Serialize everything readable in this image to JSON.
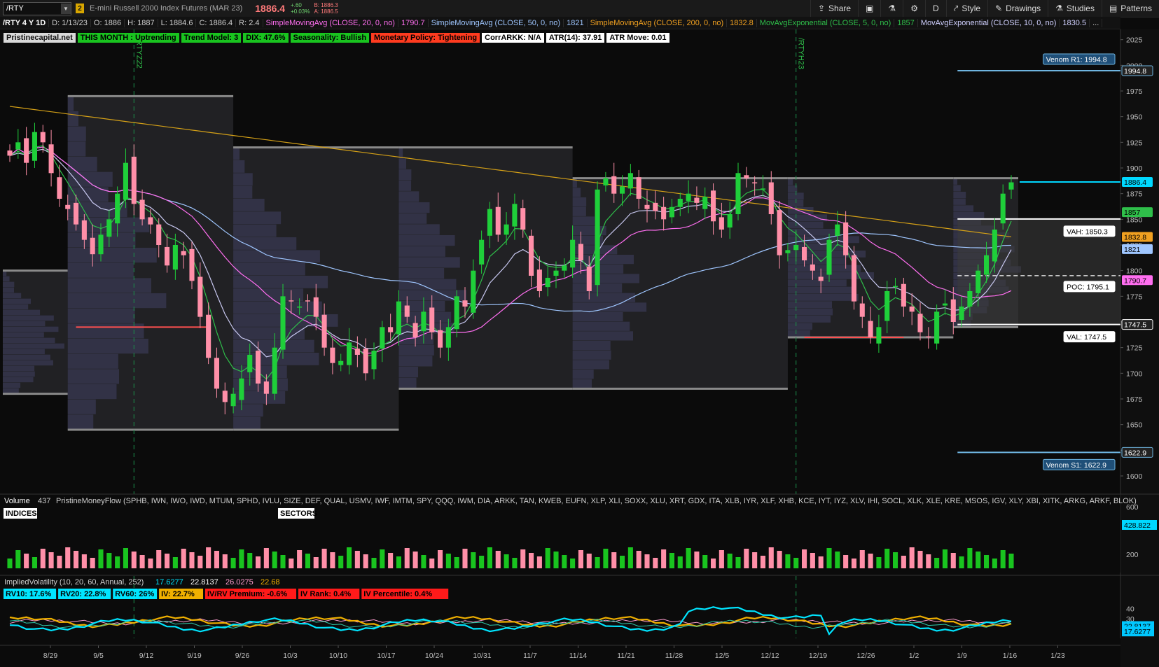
{
  "toolbar": {
    "symbol": "/RTY",
    "link_number": "2",
    "description": "E-mini Russell 2000 Index Futures (MAR 23)",
    "last": "1886.4",
    "change": "+.60",
    "change_pct": "+0.03%",
    "bid": "B: 1886.3",
    "ask": "A: 1886.5",
    "buttons": [
      {
        "label": "Share",
        "icon": "share-icon",
        "glyph": "⇪"
      },
      {
        "label": "",
        "icon": "flexible-grid-icon",
        "glyph": "▣"
      },
      {
        "label": "",
        "icon": "flask-icon",
        "glyph": "⚗"
      },
      {
        "label": "",
        "icon": "gear-icon",
        "glyph": "⚙"
      },
      {
        "label": "D",
        "icon": "",
        "glyph": ""
      },
      {
        "label": "Style",
        "icon": "style-icon",
        "glyph": "⤤"
      },
      {
        "label": "Drawings",
        "icon": "drawings-icon",
        "glyph": "✎"
      },
      {
        "label": "Studies",
        "icon": "studies-icon",
        "glyph": "⚗"
      },
      {
        "label": "Patterns",
        "icon": "patterns-icon",
        "glyph": "▤"
      }
    ]
  },
  "study_header": [
    {
      "text": "/RTY 4 Y 1D",
      "color": "#ffffff",
      "bold": true
    },
    {
      "text": "D: 1/13/23",
      "color": "#cfcfcf"
    },
    {
      "text": "O: 1886",
      "color": "#cfcfcf"
    },
    {
      "text": "H: 1887",
      "color": "#cfcfcf"
    },
    {
      "text": "L: 1884.6",
      "color": "#cfcfcf"
    },
    {
      "text": "C: 1886.4",
      "color": "#cfcfcf"
    },
    {
      "text": "R: 2.4",
      "color": "#cfcfcf"
    },
    {
      "text": "SimpleMovingAvg (CLOSE, 20, 0, no)",
      "color": "#ff6ef0"
    },
    {
      "text": "1790.7",
      "color": "#ff6ef0"
    },
    {
      "text": "SimpleMovingAvg (CLOSE, 50, 0, no)",
      "color": "#9fc6ff"
    },
    {
      "text": "1821",
      "color": "#9fc6ff"
    },
    {
      "text": "SimpleMovingAvg (CLOSE, 200, 0, no)",
      "color": "#f0a020"
    },
    {
      "text": "1832.8",
      "color": "#f0a020"
    },
    {
      "text": "MovAvgExponential (CLOSE, 5, 0, no)",
      "color": "#2fbf4a"
    },
    {
      "text": "1857",
      "color": "#2fbf4a"
    },
    {
      "text": "MovAvgExponential (CLOSE, 10, 0, no)",
      "color": "#d0d0ff"
    },
    {
      "text": "1830.5",
      "color": "#d0d0ff"
    },
    {
      "text": "...",
      "color": "#cfcfcf"
    }
  ],
  "pills": [
    {
      "text": "Pristinecapital.net",
      "bg": "#d9d9d9",
      "fg": "#111111"
    },
    {
      "text": "THIS MONTH : Uptrending",
      "bg": "#19c41f",
      "fg": "#000000"
    },
    {
      "text": "Trend Model: 3",
      "bg": "#19c41f",
      "fg": "#000000"
    },
    {
      "text": "DIX: 47.6%",
      "bg": "#19c41f",
      "fg": "#000000"
    },
    {
      "text": "Seasonality: Bullish",
      "bg": "#19c41f",
      "fg": "#000000"
    },
    {
      "text": "Monetary Policy: Tightening",
      "bg": "#ff3b1f",
      "fg": "#000000"
    },
    {
      "text": "CorrARKK: N/A",
      "bg": "#ffffff",
      "fg": "#000000"
    },
    {
      "text": "ATR(14): 37.91",
      "bg": "#ffffff",
      "fg": "#000000"
    },
    {
      "text": "ATR Move: 0.01",
      "bg": "#ffffff",
      "fg": "#000000"
    }
  ],
  "period_markers": [
    "/RTYZ22",
    "/RTYH23"
  ],
  "price_levels": {
    "venom_r1": {
      "label": "Venom R1: 1994.8",
      "value": 1994.8,
      "tag": "1994.8"
    },
    "venom_s1": {
      "label": "Venom S1: 1622.9",
      "value": 1622.9,
      "tag": "1622.9"
    },
    "vah": {
      "label": "VAH: 1850.3",
      "value": 1850.3
    },
    "poc": {
      "label": "POC: 1795.1",
      "value": 1795.1
    },
    "val": {
      "label": "VAL: 1747.5",
      "value": 1747.5,
      "tag": "1747.5"
    }
  },
  "axis_tags": [
    {
      "text": "1886.4",
      "value": 1886.4,
      "bg": "#00d8ff",
      "fg": "#000000"
    },
    {
      "text": "1857",
      "value": 1857,
      "bg": "#2fbf4a",
      "fg": "#000000"
    },
    {
      "text": "1832.8",
      "value": 1832.8,
      "bg": "#f0a020",
      "fg": "#000000"
    },
    {
      "text": "1821",
      "value": 1821,
      "bg": "#9fc6ff",
      "fg": "#000000"
    },
    {
      "text": "1790.7",
      "value": 1790.7,
      "bg": "#ff6ef0",
      "fg": "#000000"
    }
  ],
  "volume_panel": {
    "title": "Volume",
    "value": "437",
    "study": "PristineMoneyFlow (SPHB, IWN, IWO, IWD, MTUM, SPHD, IVLU, SIZE, DEF, QUAL, USMV, IWF, IMTM, SPY, QQQ, IWM, DIA, ARKK, TAN, KWEB, EUFN, XLP, XLI, SOXX, XLU, XRT, GDX, ITA, XLB, IYR, XLF, XHB, KCE, IYT, IYZ, XLV, IHI, SOCL, XLK, XLE, KRE, MSOS, IGV, XLY, XBI, XITK, ARKG, ARKF, BLOK)",
    "indices_label": "INDICES",
    "sectors_label": "SECTORS",
    "axis": [
      "600",
      "200"
    ],
    "tag": "428.822"
  },
  "iv_panel": {
    "title": "ImpliedVolatility (10, 20, 60, Annual, 252)",
    "values": [
      {
        "text": "17.6277",
        "color": "#00e5ff"
      },
      {
        "text": "22.8137",
        "color": "#ffffff"
      },
      {
        "text": "26.0275",
        "color": "#ff9ecf"
      },
      {
        "text": "22.68",
        "color": "#f0b000"
      }
    ],
    "pills": [
      {
        "text": "RV10: 17.6%",
        "bg": "#00e5ff",
        "fg": "#000000"
      },
      {
        "text": "RV20: 22.8%",
        "bg": "#00e5ff",
        "fg": "#000000"
      },
      {
        "text": "RV60: 26%",
        "bg": "#00e5ff",
        "fg": "#000000"
      },
      {
        "text": "IV: 22.7%",
        "bg": "#f0b000",
        "fg": "#000000"
      },
      {
        "text": "IV/RV Premium: -0.6%",
        "bg": "#ff1a1a",
        "fg": "#000000"
      },
      {
        "text": "IV Rank: 0.4%",
        "bg": "#ff1a1a",
        "fg": "#000000"
      },
      {
        "text": "IV Percentile: 0.4%",
        "bg": "#ff1a1a",
        "fg": "#000000"
      }
    ],
    "axis": [
      "40",
      "30",
      "20"
    ],
    "tags": [
      {
        "text": "22.8137",
        "bg": "#00c8ff"
      },
      {
        "text": "17.6277",
        "bg": "#00c8ff"
      }
    ]
  },
  "chart_data": {
    "type": "candlestick",
    "title": "/RTY 4 Y 1D",
    "ylim": [
      1585,
      2035
    ],
    "y_ticks": [
      1600,
      1625,
      1650,
      1675,
      1700,
      1725,
      1750,
      1775,
      1800,
      1825,
      1850,
      1875,
      1900,
      1925,
      1950,
      1975,
      2000,
      2025
    ],
    "x_ticks": [
      "8/29",
      "9/5",
      "9/12",
      "9/19",
      "9/26",
      "10/3",
      "10/10",
      "10/17",
      "10/24",
      "10/31",
      "11/7",
      "11/14",
      "11/21",
      "11/28",
      "12/5",
      "12/12",
      "12/19",
      "12/26",
      "1/2",
      "1/9",
      "1/16",
      "1/23"
    ],
    "closes": [
      1912,
      1925,
      1905,
      1935,
      1925,
      1895,
      1870,
      1860,
      1845,
      1830,
      1816,
      1835,
      1850,
      1875,
      1905,
      1865,
      1850,
      1845,
      1825,
      1805,
      1825,
      1815,
      1790,
      1755,
      1715,
      1685,
      1672,
      1680,
      1695,
      1718,
      1690,
      1680,
      1725,
      1775,
      1770,
      1765,
      1770,
      1755,
      1725,
      1710,
      1712,
      1730,
      1718,
      1700,
      1722,
      1745,
      1740,
      1770,
      1755,
      1735,
      1760,
      1740,
      1725,
      1745,
      1775,
      1765,
      1800,
      1830,
      1860,
      1835,
      1845,
      1865,
      1840,
      1795,
      1780,
      1793,
      1800,
      1805,
      1830,
      1810,
      1780,
      1879,
      1890,
      1875,
      1882,
      1895,
      1870,
      1860,
      1858,
      1850,
      1862,
      1870,
      1875,
      1866,
      1872,
      1848,
      1840,
      1855,
      1895,
      1890,
      1885,
      1880,
      1855,
      1815,
      1820,
      1825,
      1810,
      1800,
      1790,
      1830,
      1845,
      1815,
      1770,
      1755,
      1735,
      1745,
      1780,
      1785,
      1765,
      1760,
      1740,
      1735,
      1760,
      1768,
      1750,
      1765,
      1780,
      1800,
      1815,
      1840,
      1875,
      1886
    ],
    "ema5_last": 1857,
    "ema10_last": 1830.5,
    "sma20_last": 1790.7,
    "sma50_last": 1821,
    "sma200_last": 1832.8,
    "volume_scale_ticks": [
      200,
      600
    ]
  }
}
